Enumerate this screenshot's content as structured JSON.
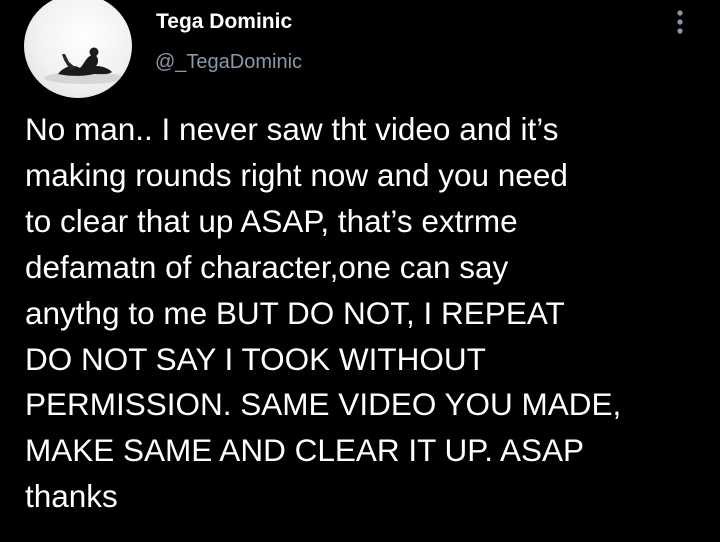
{
  "author": {
    "display_name": "Tega Dominic",
    "handle": "@_TegaDominic",
    "avatar_icon": "profile-photo"
  },
  "actions": {
    "more_icon": "more-vertical-icon"
  },
  "tweet": {
    "text": "No man.. I never saw tht video and it’s\nmaking rounds right now and you need\nto clear that up ASAP, that’s extrme\ndefamatn of character,one can say\nanythg to me BUT DO NOT, I REPEAT\nDO NOT SAY I TOOK WITHOUT\nPERMISSION. SAME VIDEO YOU MADE,\nMAKE SAME AND CLEAR IT UP. ASAP\nthanks"
  },
  "colors": {
    "background": "#000000",
    "primary_text": "#ffffff",
    "secondary_text": "#8b98a5"
  }
}
